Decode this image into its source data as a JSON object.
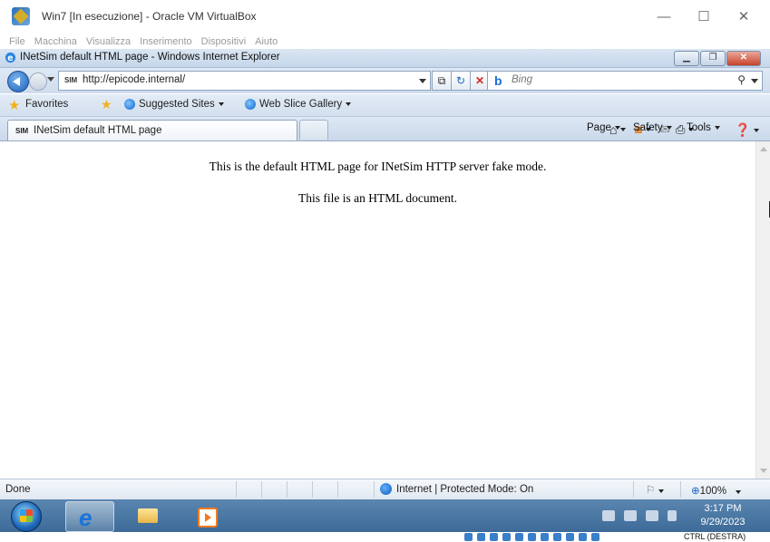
{
  "vbox": {
    "title": "Win7 [In esecuzione] - Oracle VM VirtualBox",
    "menu": [
      "File",
      "Macchina",
      "Visualizza",
      "Inserimento",
      "Dispositivi",
      "Aiuto"
    ],
    "host_key": "CTRL (DESTRA)"
  },
  "ie": {
    "window_title": "INetSim default HTML page - Windows Internet Explorer",
    "address": "http://epicode.internal/",
    "favicon_text": "SIM",
    "search_placeholder": "Bing",
    "favorites_label": "Favorites",
    "fav_links": [
      "Suggested Sites",
      "Web Slice Gallery"
    ],
    "tab_title": "INetSim default HTML page",
    "commands": [
      "Page",
      "Safety",
      "Tools"
    ]
  },
  "page": {
    "line1": "This is the default HTML page for INetSim HTTP server fake mode.",
    "line2": "This file is an HTML document."
  },
  "status": {
    "text": "Done",
    "zone": "Internet | Protected Mode: On",
    "zoom": "100%"
  },
  "taskbar": {
    "time": "3:17 PM",
    "date": "9/29/2023"
  },
  "colors": {
    "ie_chrome": "#d3dfee",
    "taskbar": "#4a78a6",
    "close_red": "#c7432a"
  }
}
